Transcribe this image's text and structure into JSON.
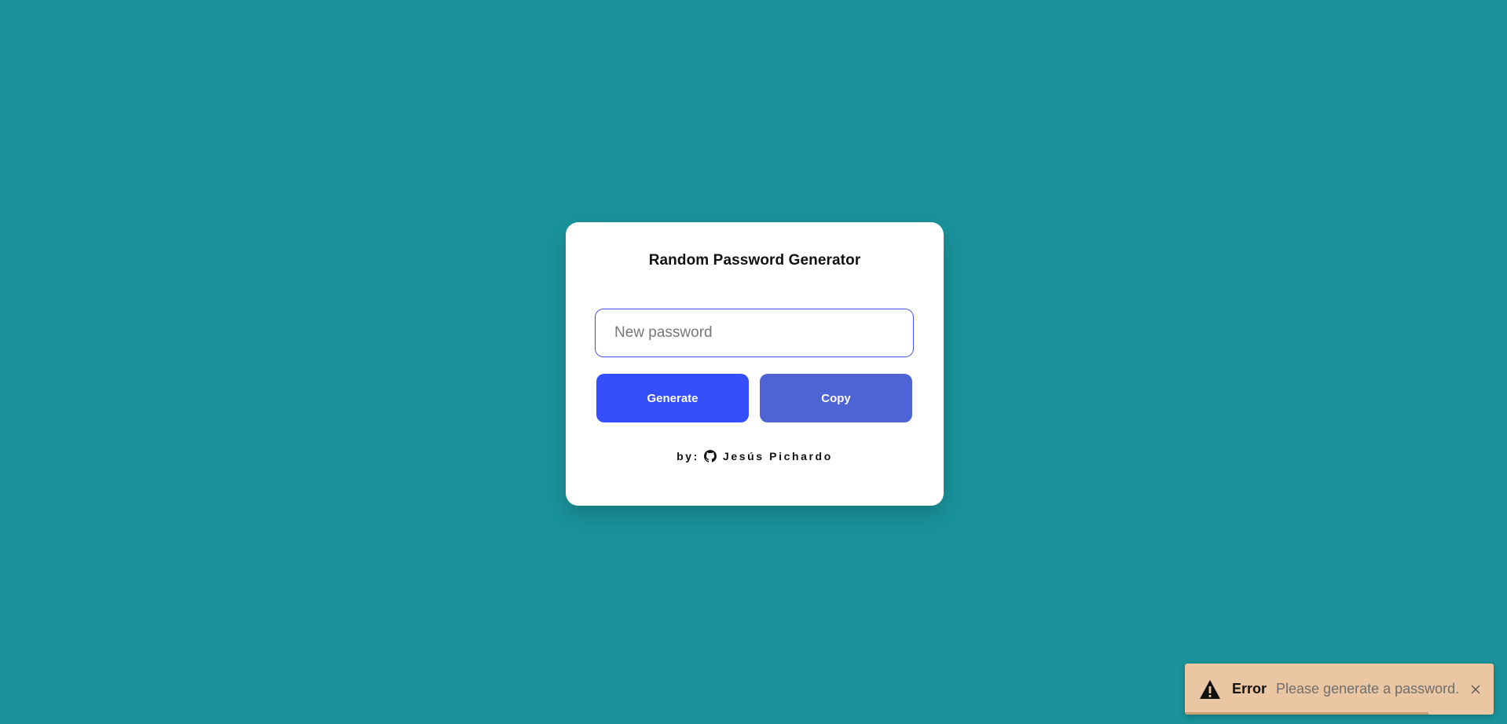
{
  "page": {
    "background_color": "#1a939b"
  },
  "card": {
    "title": "Random Password Generator",
    "password_input": {
      "value": "",
      "placeholder": "New password"
    },
    "buttons": {
      "generate_label": "Generate",
      "copy_label": "Copy"
    },
    "credit": {
      "prefix": "by:",
      "icon": "github-icon",
      "author": "Jesús Pichardo"
    },
    "colors": {
      "generate": "#344ef9",
      "copy": "#4e64d4",
      "input_border": "#3d52e8"
    }
  },
  "toast": {
    "type": "warning",
    "icon": "warning-icon",
    "title": "Error",
    "message": "Please generate a password.",
    "close_icon": "close-icon",
    "progress": 0.79,
    "background_color": "#eac7a2"
  }
}
